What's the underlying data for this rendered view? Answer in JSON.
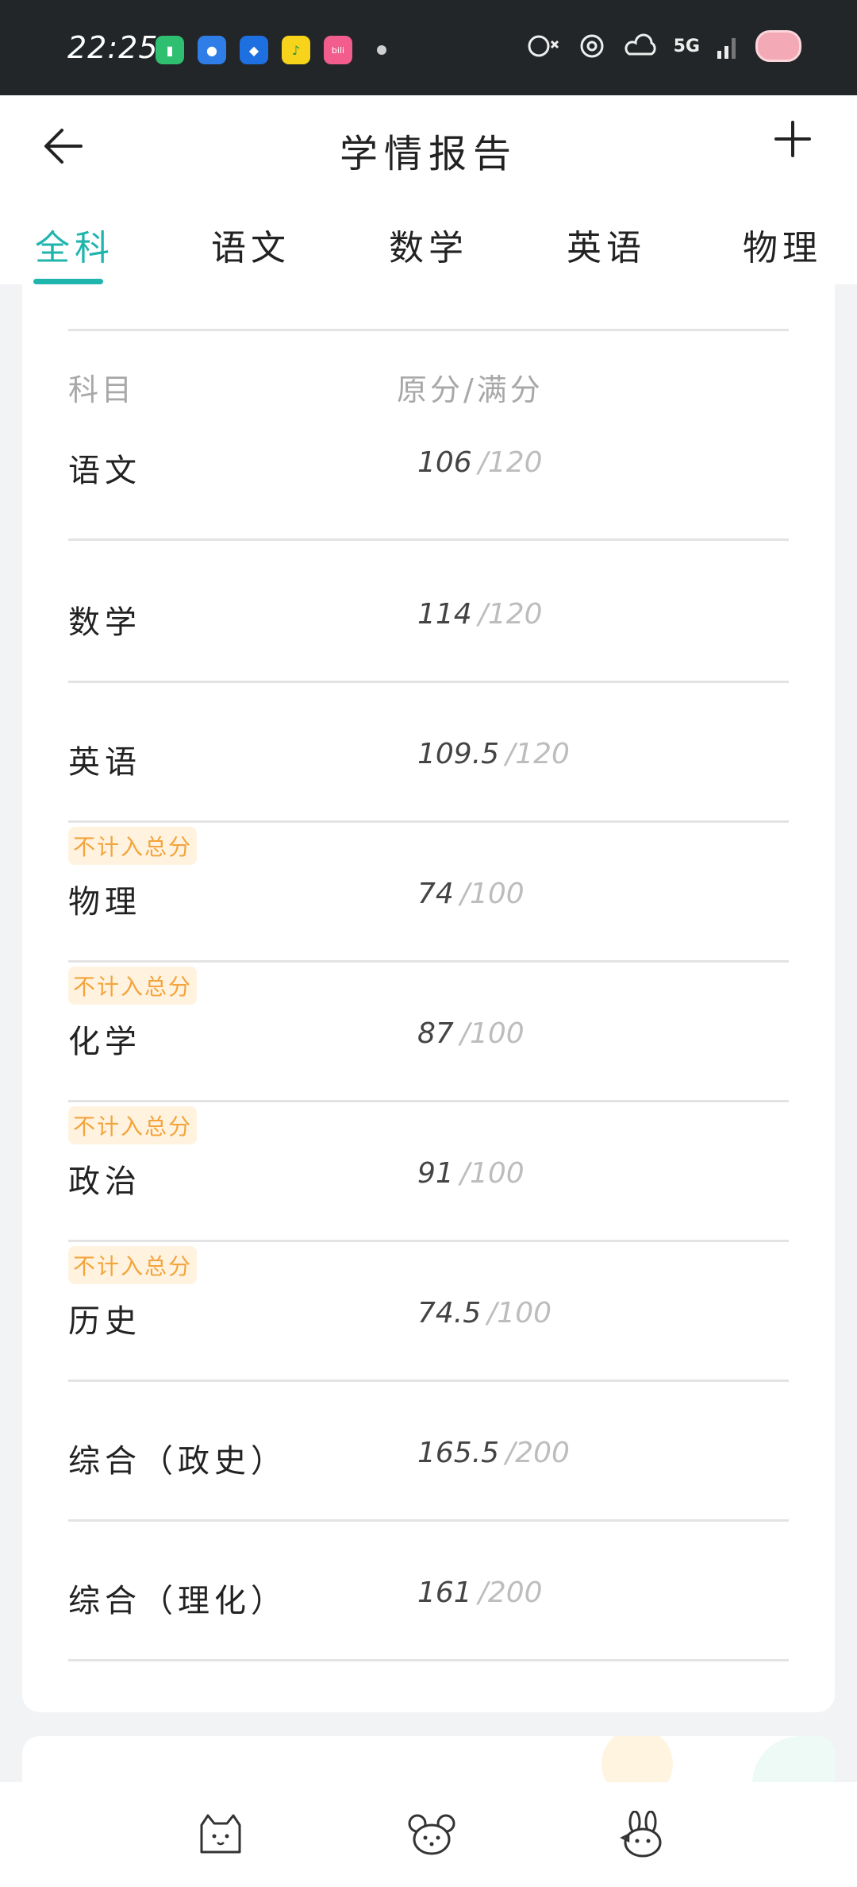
{
  "status_bar": {
    "time": "22:25",
    "network": "5G",
    "app_icons": [
      "battery-app-icon",
      "health-app-icon",
      "security-app-icon",
      "music-app-icon",
      "bilibili-app-icon"
    ],
    "system_icons": [
      "alarm-mute-icon",
      "settings-ring-icon",
      "weather-icon",
      "signal-icon",
      "pig-avatar-icon"
    ]
  },
  "header": {
    "title": "学情报告"
  },
  "tabs": [
    {
      "label": "全科",
      "active": true
    },
    {
      "label": "语文"
    },
    {
      "label": "数学"
    },
    {
      "label": "英语"
    },
    {
      "label": "物理"
    }
  ],
  "table": {
    "col_subject": "科目",
    "col_score": "原分/满分",
    "rows": [
      {
        "subject": "语文",
        "score": "106",
        "full": "/120",
        "badge": ""
      },
      {
        "subject": "数学",
        "score": "114",
        "full": "/120",
        "badge": ""
      },
      {
        "subject": "英语",
        "score": "109.5",
        "full": "/120",
        "badge": ""
      },
      {
        "subject": "物理",
        "score": "74",
        "full": "/100",
        "badge": "不计入总分"
      },
      {
        "subject": "化学",
        "score": "87",
        "full": "/100",
        "badge": "不计入总分"
      },
      {
        "subject": "政治",
        "score": "91",
        "full": "/100",
        "badge": "不计入总分"
      },
      {
        "subject": "历史",
        "score": "74.5",
        "full": "/100",
        "badge": "不计入总分"
      },
      {
        "subject": "综合（政史）",
        "score": "165.5",
        "full": "/200",
        "badge": ""
      },
      {
        "subject": "综合（理化）",
        "score": "161",
        "full": "/200",
        "badge": ""
      }
    ]
  },
  "bottom_nav": [
    "cat-face-icon",
    "mouse-face-icon",
    "bunny-face-icon"
  ],
  "colors": {
    "accent": "#1fb5ad",
    "badge_text": "#f3a43c",
    "badge_bg": "#fff3e0",
    "status_bar": "#222628"
  }
}
